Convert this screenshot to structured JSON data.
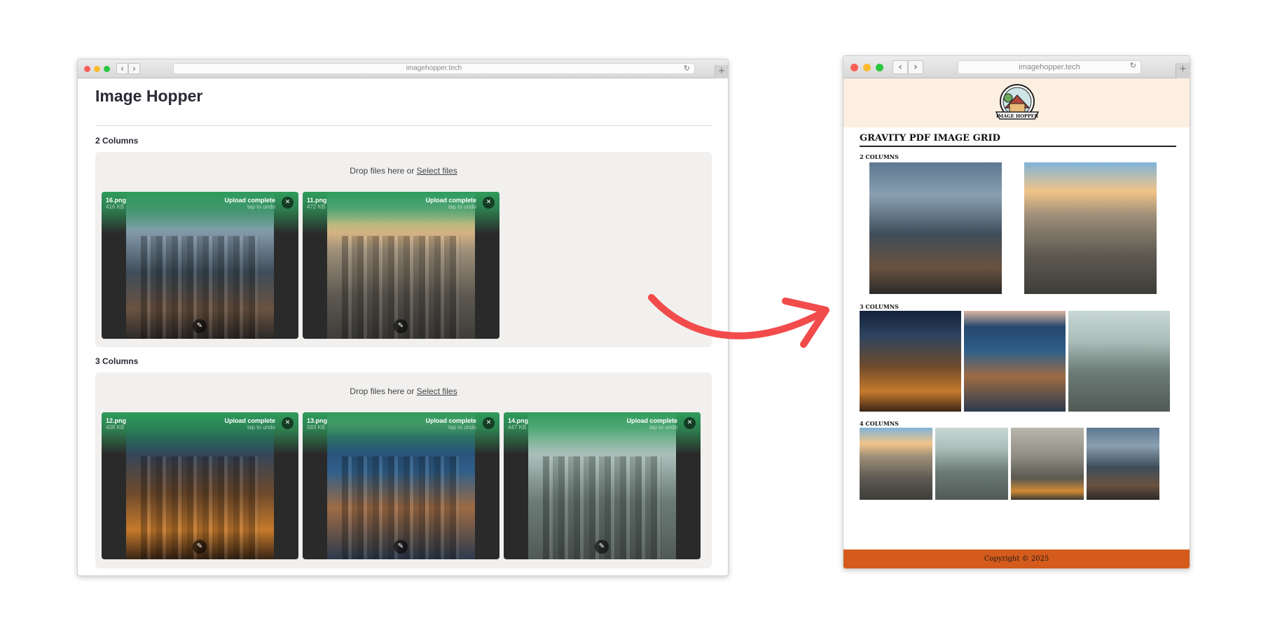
{
  "left_window": {
    "url": "imagehopper.tech",
    "app_title": "Image Hopper",
    "sections": [
      {
        "label": "2 Columns",
        "dropzone_text": "Drop files here or",
        "dropzone_link": "Select files",
        "files": [
          {
            "name": "16.png",
            "size": "416 KB",
            "status": "Upload complete",
            "undo": "tap to undo"
          },
          {
            "name": "11.png",
            "size": "472 KB",
            "status": "Upload complete",
            "undo": "tap to undo"
          }
        ]
      },
      {
        "label": "3 Columns",
        "dropzone_text": "Drop files here or",
        "dropzone_link": "Select files",
        "files": [
          {
            "name": "12.png",
            "size": "409 KB",
            "status": "Upload complete",
            "undo": "tap to undo"
          },
          {
            "name": "13.png",
            "size": "583 KB",
            "status": "Upload complete",
            "undo": "tap to undo"
          },
          {
            "name": "14.png",
            "size": "447 KB",
            "status": "Upload complete",
            "undo": "tap to undo"
          }
        ]
      }
    ]
  },
  "right_window": {
    "url": "imagehopper.tech",
    "logo_text": "IMAGE HOPPER",
    "title": "GRAVITY PDF IMAGE GRID",
    "sections": [
      "2 COLUMNS",
      "3 COLUMNS",
      "4 COLUMNS"
    ],
    "footer": "Copyright © 2025"
  },
  "icons": {
    "close": "✕",
    "edit": "✎",
    "back": "‹",
    "forward": "›",
    "reload": "↻",
    "new_tab": "+"
  },
  "colors": {
    "upload_green": "#2f9c5c",
    "arrow_red": "#f24b4b",
    "header_cream": "#fcefe1",
    "footer_orange": "#d45b1b"
  }
}
